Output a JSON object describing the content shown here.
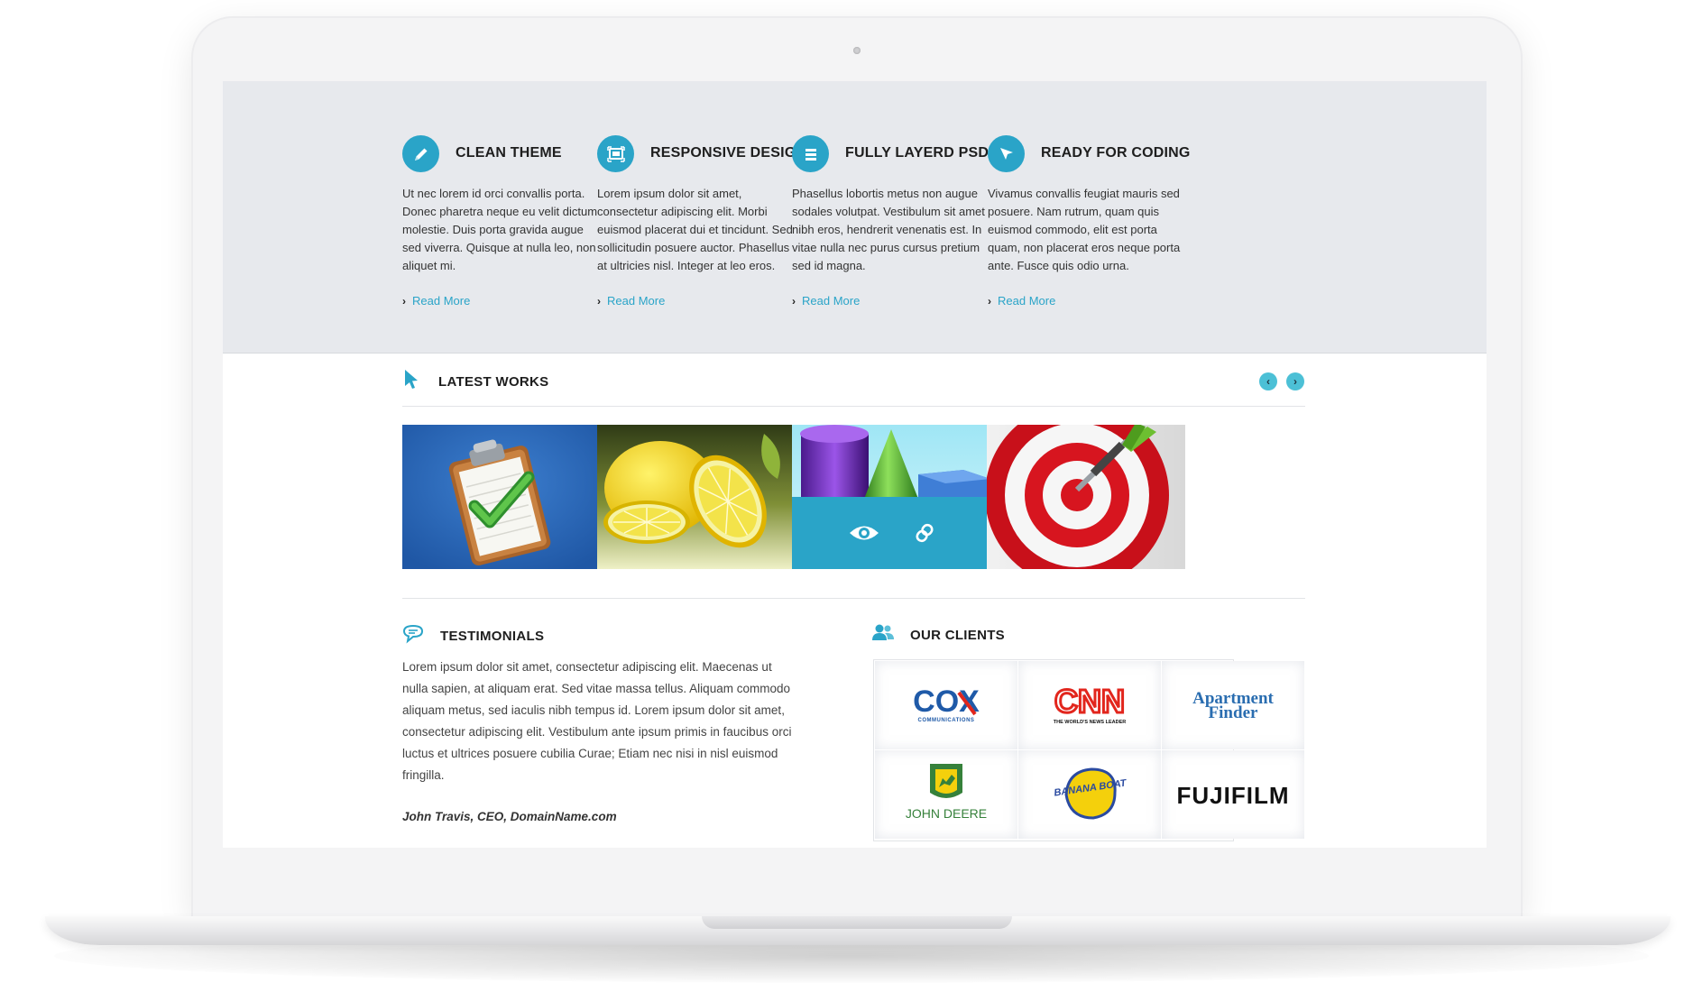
{
  "features": [
    {
      "icon": "pencil-icon",
      "title": "CLEAN THEME",
      "text": "Ut nec lorem id orci convallis porta. Donec pharetra neque eu velit dictum molestie. Duis porta gravida augue sed viverra. Quisque at nulla leo, non aliquet mi.",
      "link": "Read More"
    },
    {
      "icon": "responsive-icon",
      "title": "RESPONSIVE DESIGN",
      "text": "Lorem ipsum dolor sit amet, consectetur adipiscing elit. Morbi euismod placerat dui et tincidunt. Sed sollicitudin posuere auctor. Phasellus at ultricies nisl. Integer at leo eros.",
      "link": "Read More"
    },
    {
      "icon": "layers-icon",
      "title": "FULLY LAYERD PSD",
      "text": "Phasellus lobortis metus non augue sodales volutpat. Vestibulum sit amet nibh eros, hendrerit venenatis est. In vitae nulla nec purus cursus pretium sed id magna.",
      "link": "Read More"
    },
    {
      "icon": "cursor-icon",
      "title": "READY FOR CODING",
      "text": "Vivamus convallis feugiat mauris sed posuere. Nam rutrum, quam quis euismod commodo, elit est porta quam, non placerat eros neque porta ante. Fusce quis odio urna.",
      "link": "Read More"
    }
  ],
  "latest_works": {
    "title": "LATEST WORKS",
    "icon": "pointer-icon",
    "prev_icon": "chevron-left-icon",
    "next_icon": "chevron-right-icon",
    "items": [
      {
        "image": "clipboard-checkmark-image"
      },
      {
        "image": "lemons-image"
      },
      {
        "image": "geometric-shapes-image",
        "overlay_icons": [
          "eye-icon",
          "link-icon"
        ]
      },
      {
        "image": "target-dart-image"
      }
    ]
  },
  "testimonials": {
    "title": "TESTIMONIALS",
    "icon": "speech-bubble-icon",
    "text": "Lorem ipsum dolor sit amet, consectetur adipiscing elit. Maecenas ut nulla sapien, at aliquam erat. Sed vitae massa tellus. Aliquam commodo aliquam metus, sed iaculis nibh tempus id. Lorem ipsum dolor sit amet, consectetur adipiscing elit. Vestibulum ante ipsum primis in faucibus orci luctus et ultrices posuere cubilia Curae; Etiam nec nisi in nisl euismod fringilla.",
    "author": "John Travis, CEO, DomainName.com"
  },
  "clients": {
    "title": "OUR CLIENTS",
    "icon": "users-icon",
    "logos": [
      {
        "name": "COX",
        "sub": "COMMUNICATIONS"
      },
      {
        "name": "CNN",
        "sub": "THE WORLD'S NEWS LEADER"
      },
      {
        "name": "Apartment",
        "sub": "Finder"
      },
      {
        "name": "JOHN DEERE"
      },
      {
        "name": "BANANA BOAT"
      },
      {
        "name": "FUJIFILM"
      }
    ]
  },
  "colors": {
    "accent": "#2aa4c8",
    "feature_bg": "#e7e9ed",
    "arrow_bg": "#4cc0d6",
    "cox": "#1f5aa8",
    "cnn": "#e2261d",
    "apartment_finder": "#2a6db0",
    "john_deere": "#36813b"
  }
}
